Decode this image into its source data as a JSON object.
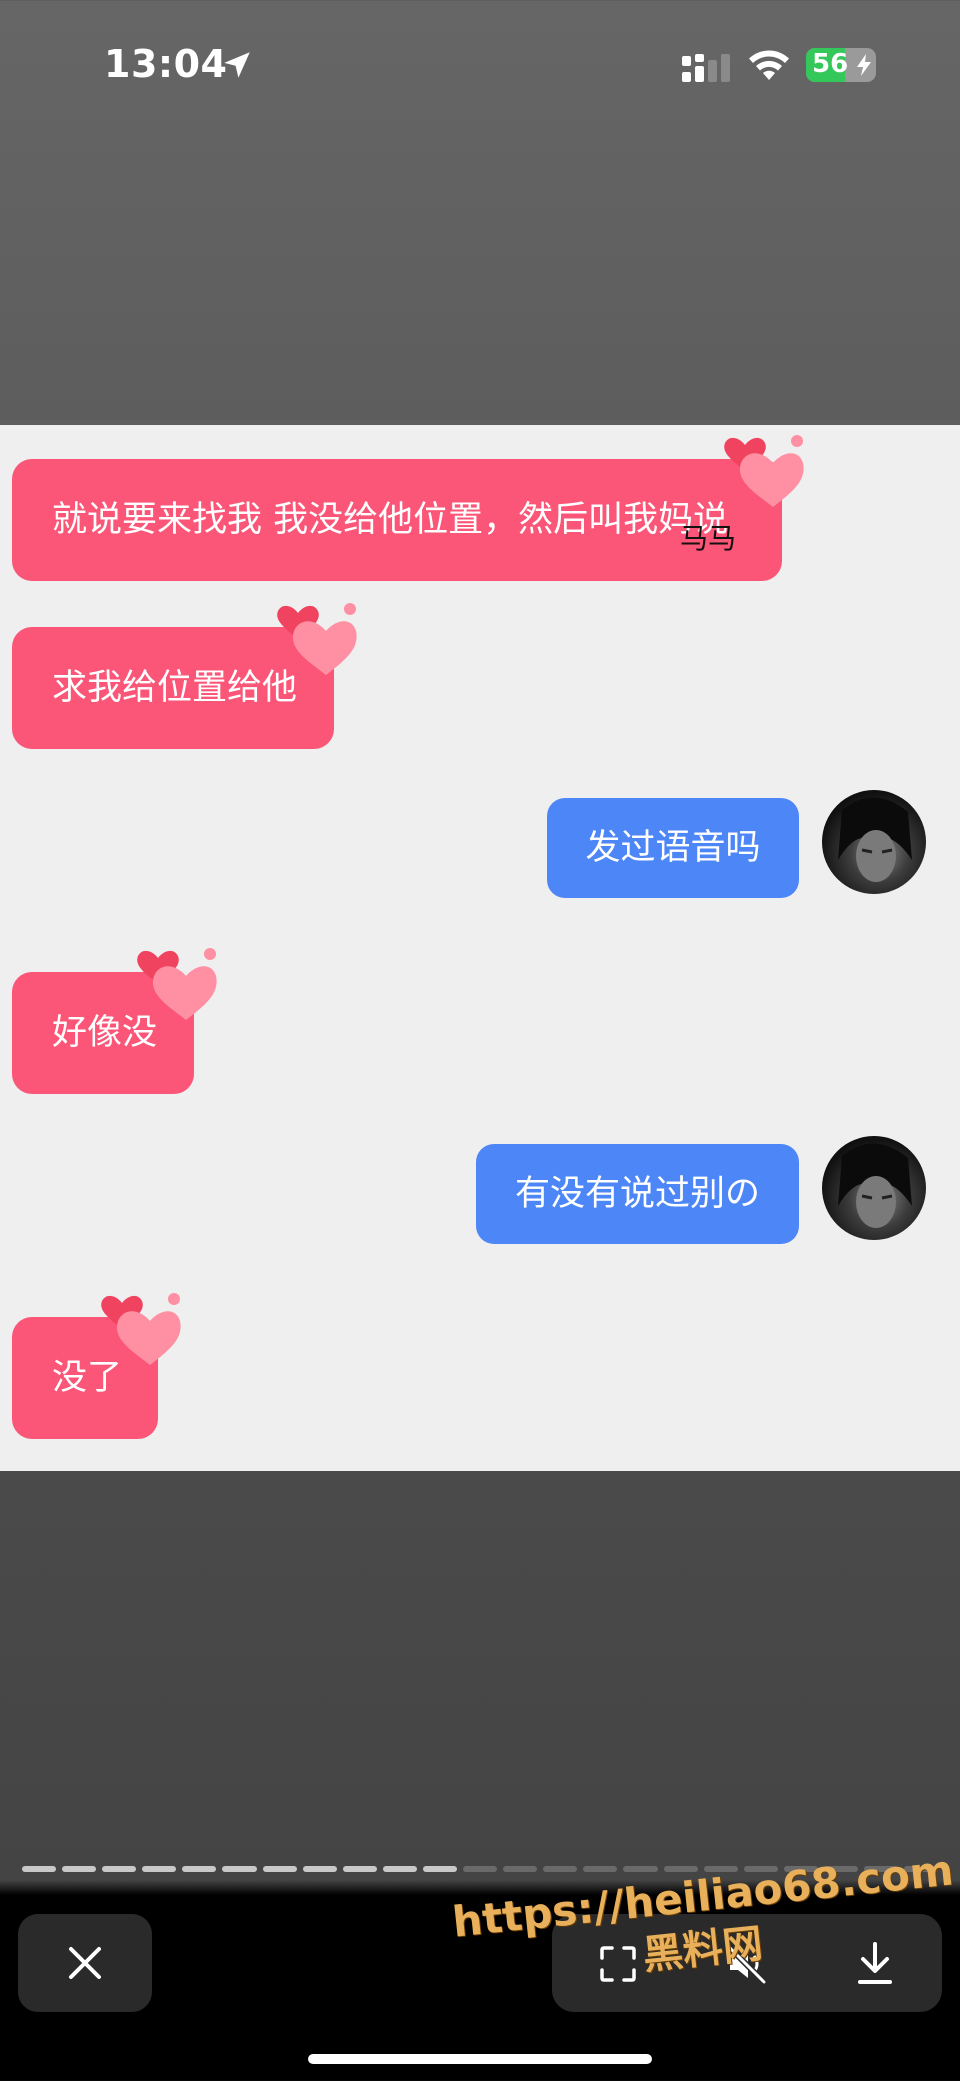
{
  "status_bar": {
    "time": "13:04",
    "battery": "56",
    "battery_level": 0.56
  },
  "messages": [
    {
      "side": "received",
      "text": "就说要来找我  我没给他位置，然后叫我妈说",
      "overlay": "马马"
    },
    {
      "side": "received",
      "text": "求我给位置给他"
    },
    {
      "side": "sent",
      "text": "发过语音吗"
    },
    {
      "side": "received",
      "text": "好像没"
    },
    {
      "side": "sent",
      "text": "有没有说过别の"
    },
    {
      "side": "received",
      "text": "没了"
    }
  ],
  "progress": {
    "total_segments": 23,
    "completed_segments": 11
  },
  "controls": {
    "close_icon": "close-icon",
    "scan_icon": "scan-icon",
    "mute_icon": "speaker-muted-icon",
    "download_icon": "download-icon"
  },
  "watermark": {
    "url": "https://heiliao68.com",
    "name": "黑料网"
  },
  "colors": {
    "received_bubble": "#fb5577",
    "sent_bubble": "#4c86f7",
    "chat_bg": "#efeff0",
    "battery_green": "#34c759"
  }
}
